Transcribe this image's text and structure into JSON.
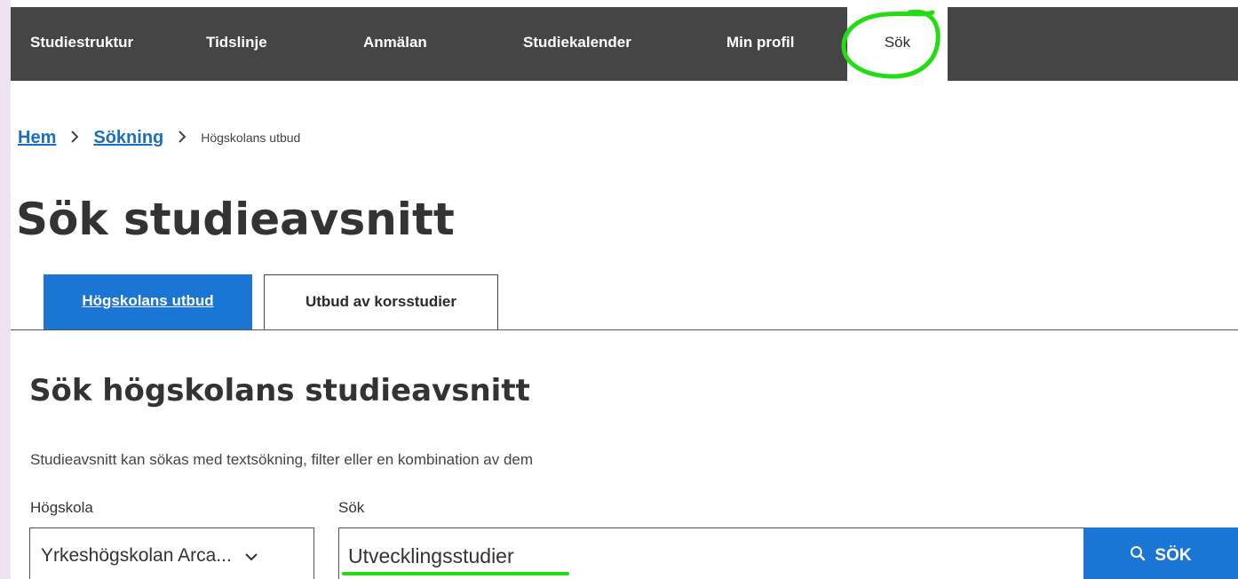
{
  "nav": {
    "items": [
      "Studiestruktur",
      "Tidslinje",
      "Anmälan",
      "Studiekalender",
      "Min profil",
      "Sök"
    ]
  },
  "breadcrumb": {
    "home": "Hem",
    "search": "Sökning",
    "current": "Högskolans utbud"
  },
  "page_title": "Sök studieavsnitt",
  "tabs": [
    "Högskolans utbud",
    "Utbud av korsstudier"
  ],
  "section_title": "Sök högskolans studieavsnitt",
  "intro": "Studieavsnitt kan sökas med textsökning, filter eller en kombination av dem",
  "form": {
    "school_label": "Högskola",
    "school_value": "Yrkeshögskolan Arca...",
    "search_label": "Sök",
    "search_value": "Utvecklingsstudier",
    "search_button": "SÖK"
  },
  "colors": {
    "nav_bg": "#454545",
    "accent_blue": "#1b75d4",
    "link_blue": "#1b6fc2",
    "annotation_green": "#22dd11"
  },
  "icons": [
    "chevron-right-icon",
    "chevron-down-icon",
    "search-icon"
  ]
}
